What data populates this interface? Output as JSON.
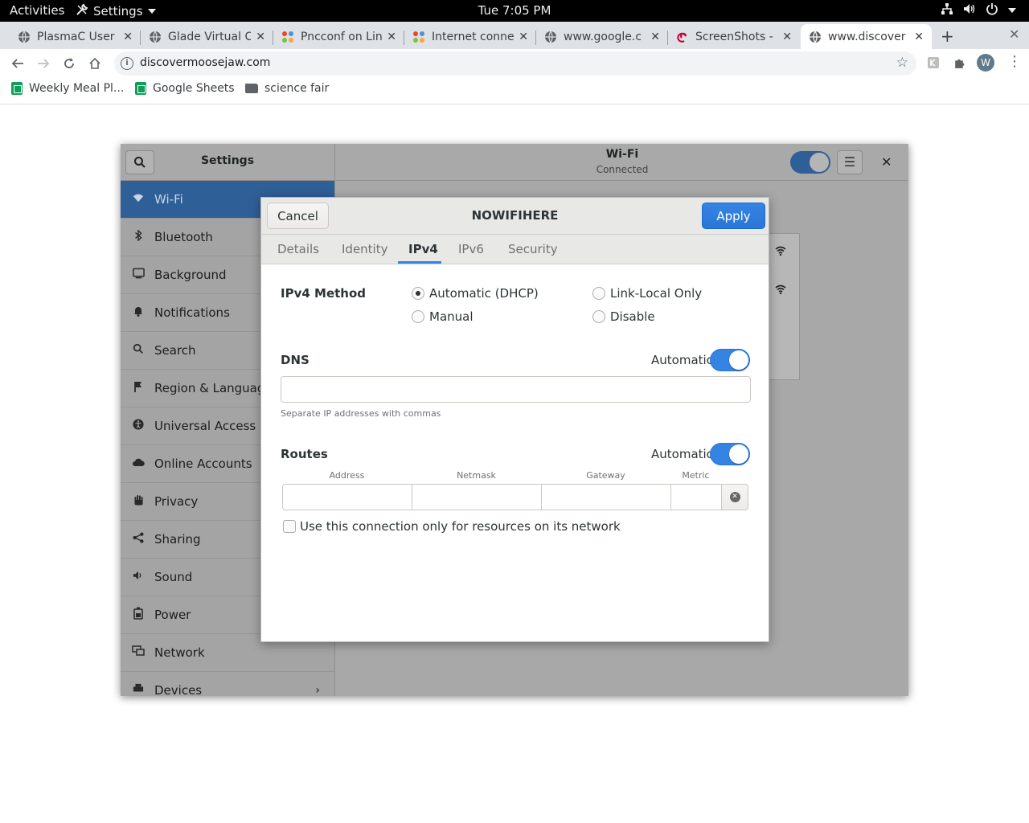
{
  "topbar": {
    "activities": "Activities",
    "app_menu": "Settings",
    "clock": "Tue  7:05 PM"
  },
  "browser": {
    "tabs": [
      {
        "label": "PlasmaC User",
        "icon": "globe-icon"
      },
      {
        "label": "Glade Virtual C",
        "icon": "globe-icon"
      },
      {
        "label": "Pncconf on Lin",
        "icon": "joomla-icon"
      },
      {
        "label": "Internet conne",
        "icon": "joomla-icon"
      },
      {
        "label": "www.google.c",
        "icon": "globe-icon"
      },
      {
        "label": "ScreenShots -",
        "icon": "debian-icon"
      },
      {
        "label": "www.discover",
        "icon": "globe-icon",
        "active": true
      }
    ],
    "url": "discovermoosejaw.com",
    "profile_initial": "W",
    "bookmarks": [
      {
        "label": "Weekly Meal Pl...",
        "icon": "sheets-icon"
      },
      {
        "label": "Google Sheets",
        "icon": "sheets-icon"
      },
      {
        "label": "science fair",
        "icon": "folder-icon"
      }
    ]
  },
  "settings": {
    "title": "Settings",
    "panel_title": "Wi-Fi",
    "panel_subtitle": "Connected",
    "wifi_enabled": true,
    "sidebar": [
      {
        "label": "Wi-Fi",
        "icon": "wifi-icon",
        "selected": true
      },
      {
        "label": "Bluetooth",
        "icon": "bluetooth-icon"
      },
      {
        "label": "Background",
        "icon": "background-icon"
      },
      {
        "label": "Notifications",
        "icon": "bell-icon"
      },
      {
        "label": "Search",
        "icon": "search-icon"
      },
      {
        "label": "Region & Language",
        "icon": "flag-icon"
      },
      {
        "label": "Universal Access",
        "icon": "accessibility-icon"
      },
      {
        "label": "Online Accounts",
        "icon": "cloud-icon"
      },
      {
        "label": "Privacy",
        "icon": "hand-icon"
      },
      {
        "label": "Sharing",
        "icon": "share-icon"
      },
      {
        "label": "Sound",
        "icon": "speaker-icon"
      },
      {
        "label": "Power",
        "icon": "battery-icon"
      },
      {
        "label": "Network",
        "icon": "network-icon"
      },
      {
        "label": "Devices",
        "icon": "printer-icon"
      }
    ]
  },
  "dialog": {
    "title": "NOWIFIHERE",
    "cancel": "Cancel",
    "apply": "Apply",
    "tabs": [
      "Details",
      "Identity",
      "IPv4",
      "IPv6",
      "Security"
    ],
    "active_tab": "IPv4",
    "ipv4_method_label": "IPv4 Method",
    "methods": {
      "auto": "Automatic (DHCP)",
      "link_local": "Link-Local Only",
      "manual": "Manual",
      "disable": "Disable"
    },
    "selected_method": "Automatic (DHCP)",
    "dns_label": "DNS",
    "dns_automatic_label": "Automatic",
    "dns_automatic": true,
    "dns_value": "",
    "dns_hint": "Separate IP addresses with commas",
    "routes_label": "Routes",
    "routes_automatic_label": "Automatic",
    "routes_automatic": true,
    "route_columns": [
      "Address",
      "Netmask",
      "Gateway",
      "Metric"
    ],
    "only_resources_label": "Use this connection only for resources on its network",
    "only_resources_checked": false
  }
}
